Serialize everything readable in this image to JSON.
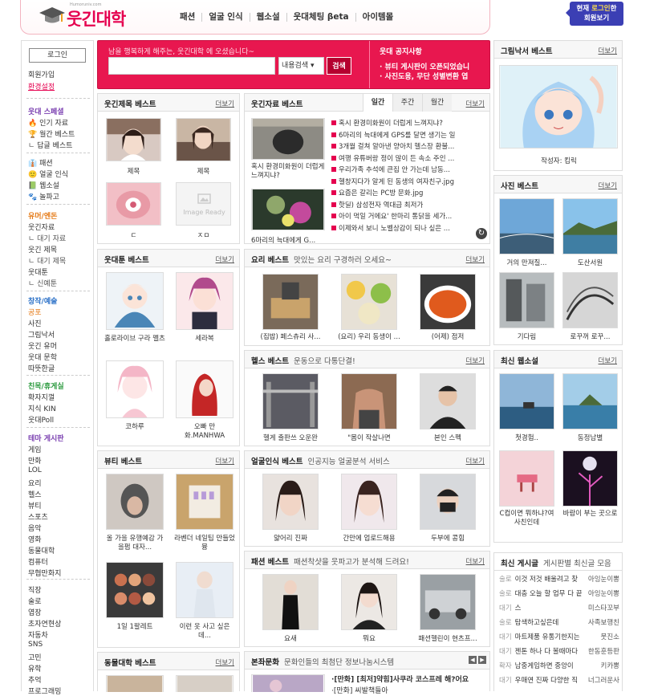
{
  "header": {
    "logo_text": "웃긴대학",
    "logo_sub": "Humoruniv.com",
    "nav": [
      "패션",
      "얼굴 인식",
      "웹소설",
      "웃대체팅 βeta",
      "아이템몰"
    ],
    "who": [
      "현재 로그인한",
      "회원보기"
    ],
    "who_hl": "로그인"
  },
  "left": {
    "login": "로그인",
    "links": [
      "회원가입",
      "환경설정"
    ],
    "sec1": {
      "title": "웃대 스페셜",
      "items": [
        "인기 자료",
        "월간 베스트",
        "답글 베스트"
      ]
    },
    "sec2": {
      "items": [
        "패션",
        "얼굴 인식",
        "웹소설",
        "놀파고"
      ]
    },
    "sec3": {
      "title": "유머/엔돈",
      "items": [
        "웃긴자료",
        "대기 자료",
        "웃긴 제목",
        "대기 제목",
        "웃대툰",
        "신예툰"
      ]
    },
    "sec4": {
      "title": "창작/예술",
      "items": [
        "공포",
        "사진",
        "그림낙서",
        "웃긴 유머",
        "웃대 문학",
        "따뜻한글"
      ]
    },
    "sec5": {
      "title": "친목/휴게실",
      "items": [
        "확자지껄",
        "지식 KIN",
        "웃대Poll"
      ]
    },
    "sec6": {
      "title": "테마 게시판",
      "items": [
        "게임",
        "만화",
        "LOL",
        "요리",
        "헬스",
        "뷰티",
        "스포츠",
        "음악",
        "영화",
        "동물대학",
        "컴퓨터",
        "무협만화지"
      ]
    },
    "sec7": {
      "items": [
        "직장",
        "술로",
        "엽장",
        "초자연현상",
        "자동차",
        "SNS",
        "고민",
        "유학",
        "추억",
        "프로그래밍"
      ]
    }
  },
  "search": {
    "welcome": "남을 행복하게 해주는, 웃긴대학 에 오셨습니다~",
    "select": "내용검색",
    "button": "검색"
  },
  "notice": {
    "title": "웃대 공지사항",
    "items": [
      "· 뷰티 게시판이 오픈되었습니",
      "· 사진도용, 무단 성별변환 엽"
    ]
  },
  "box_title": {
    "title": "웃긴제목 베스트",
    "more": "더보기",
    "caps": [
      "제목",
      "제목",
      "ㄷ",
      "ㅈㅁ"
    ],
    "image_ready": "Image Ready"
  },
  "box_jaryo": {
    "title": "웃긴자료 베스트",
    "more": "더보기",
    "tabs": [
      "일간",
      "주간",
      "월간"
    ],
    "items": [
      "혹시 환경미화원이 더럽게 느껴지냐?",
      "6마리의 늑대에게 GPS를 달면 생기는 일",
      "3개월 걸쳐 알아낸 양아치 헬스장 환불...",
      "여행 유튜버랑 정이 많이 든 속소 주인 ...",
      "우리가족 추석에 큰집 안 가는데 남동...",
      "헬창지다가 알게 된 동생의 여자친구.jpg",
      "요즘은 갈리는 PC방 문화.jpg",
      "핫딜) 삼성전자 역대급 최저가",
      "아이 먹일 거에요' 한마리 통닭을 세가...",
      "이제와서 보니 노벨상감이 되나 싶은 ..."
    ],
    "cap1": "혹시 환경미화원이 더럽게 느껴지냐?",
    "cap2": "6마리의 늑대에게 G..."
  },
  "box_grim": {
    "title": "그림낙서 베스트",
    "more": "더보기",
    "author": "작성자: 킴릭"
  },
  "box_photo": {
    "title": "사진 베스트",
    "more": "더보기",
    "caps": [
      "거의 만져질...",
      "도산서원",
      "기다림",
      "로꾸꺼 로꾸..."
    ]
  },
  "box_toon": {
    "title": "웃대툰 베스트",
    "more": "더보기",
    "caps": [
      "홀로라이브 구라 펠츠",
      "세라복",
      "코하루",
      "오빠 만화.MANHWA"
    ]
  },
  "box_cook": {
    "title": "요리 베스트",
    "sub": "맛있는 요리 구경하러 오세요~",
    "more": "더보기",
    "caps": [
      "(집밥) 페스츄리 사...",
      "(요리) 우리 동생이 ...",
      "(어제) 점저"
    ]
  },
  "box_health": {
    "title": "헬스 베스트",
    "sub": "운동으로 다통단결!",
    "more": "더보기",
    "caps": [
      "헬게 출판쓰 오운완",
      "\"몸이 작살나면",
      "본인 스펙"
    ]
  },
  "box_webnovel": {
    "title": "최신 웹소설",
    "more": "더보기",
    "caps": [
      "첫경험..",
      "동정남별",
      "C컵이면 뭐하냐?여사친인데",
      "바람이 부는 곳으로"
    ]
  },
  "box_beauty": {
    "title": "뷰티 베스트",
    "more": "더보기",
    "caps": [
      "올 가을 유행예감 가을펌 대자...",
      "라벤더 네일팁 만들었뮹",
      "1일 1팔레트",
      "이런 옷 사고 싶은데..."
    ]
  },
  "box_face": {
    "title": "얼굴인식 베스트",
    "sub": "인공지능 얼굴분석 서비스",
    "more": "더보기",
    "caps": [
      "얇어리 진짜",
      "간만에 업로드해용",
      "두부에 콩힘"
    ]
  },
  "box_fashion": {
    "title": "패션 베스트",
    "sub": "패션착샷을 웃파고가 분석해 드려요!",
    "more": "더보기",
    "caps": [
      "요새",
      "뭐요",
      "패션헬린이 현츠프..."
    ]
  },
  "box_recent": {
    "title": "최신 게시글",
    "sub": "게시판별 최신글 모음",
    "rows": [
      [
        "술로",
        "이것 저것 배울려고 찾",
        "아잉눈이뽕"
      ],
      [
        "술로",
        "대충 오늘 할 업무 다 끝",
        "아잉눈이뽕"
      ],
      [
        "대기",
        "스",
        "미스타꼬부"
      ],
      [
        "술로",
        "탐색하고싶은데",
        "사족보행친"
      ],
      [
        "대기",
        "마트제품 유통기한지는",
        "뭇진소"
      ],
      [
        "대기",
        "젠톤 하나 다 볼때마다",
        "한동훈등판"
      ],
      [
        "확자",
        "남중게임하면 중앙이 ",
        "키카뽕"
      ],
      [
        "대기",
        "우매연 진짜 다양한 직",
        "너그러운사"
      ]
    ]
  },
  "box_animal": {
    "title": "동물대학 베스트",
    "more": "더보기"
  },
  "box_culture": {
    "title": "본좌문화",
    "sub": "문화인들의 최첨단 정보나눔시스템",
    "items": [
      "·[만화] [최저]약힘]사쿠라 코스프레 해?어요",
      "·[만화] 씨발책들아"
    ]
  }
}
